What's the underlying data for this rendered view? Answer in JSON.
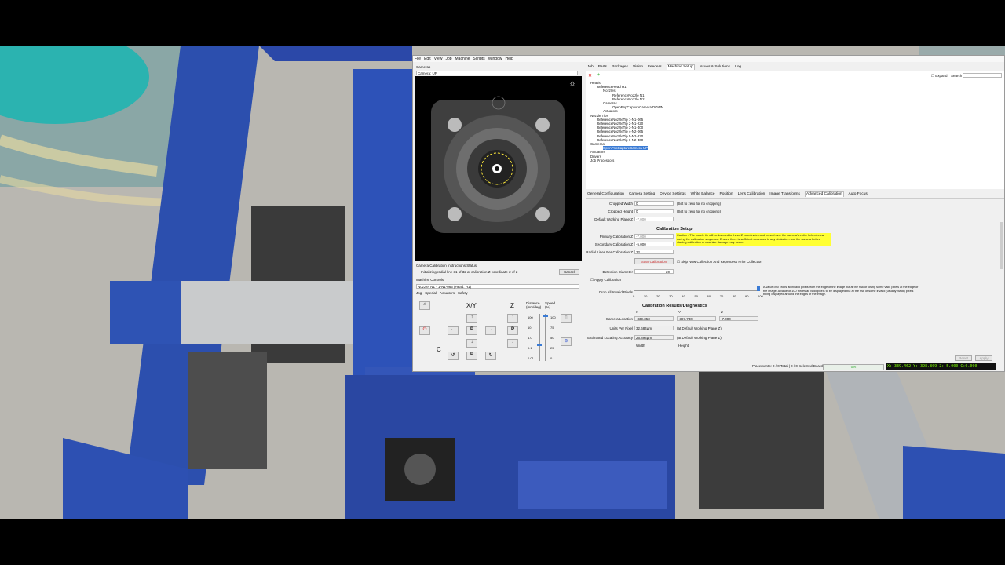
{
  "menu": [
    "File",
    "Edit",
    "View",
    "Job",
    "Machine",
    "Scripts",
    "Window",
    "Help"
  ],
  "camera_panel": {
    "title": "Cameras",
    "selected": "Camera: UP"
  },
  "calibration_status": {
    "title": "Camera Calibration Instructions/Status",
    "message": "Initializing radial line 31 of 32 at calibration Z coordinate 2 of 2",
    "cancel_label": "Cancel"
  },
  "machine_controls": {
    "title": "Machine Controls",
    "nozzle": "Nozzle: N1 - 1-N1-065 (Head: H1)",
    "tabs": [
      "Jog",
      "Special",
      "Actuators",
      "Safety"
    ],
    "xy_label": "X/Y",
    "z_label": "Z",
    "c_label": "C",
    "park_label": "P",
    "distance_label": "Distance (mm/deg)",
    "speed_label": "Speed (%)",
    "distance_ticks": [
      "100",
      "10",
      "1.0",
      "0.1",
      "0.01"
    ],
    "speed_ticks": [
      "100",
      "75",
      "50",
      "25",
      "0"
    ]
  },
  "right_tabs": [
    "Job",
    "Parts",
    "Packages",
    "Vision",
    "Feeders",
    "Machine Setup",
    "Issues & Solutions",
    "Log"
  ],
  "active_right_tab": "Machine Setup",
  "expand_label": "Expand",
  "search_label": "Search",
  "tree": [
    "Heads",
    "ReferenceHead H1",
    "Nozzles",
    "ReferenceNozzle N1",
    "ReferenceNozzle N2",
    "Cameras",
    "OpenPnpCaptureCamera DOWN",
    "Actuators",
    "Nozzle Tips",
    "ReferenceNozzleTip 1-N1-065",
    "ReferenceNozzleTip 2-N1-220",
    "ReferenceNozzleTip 3-N1-400",
    "ReferenceNozzleTip 4-N2-065",
    "ReferenceNozzleTip 5-N2-220",
    "ReferenceNozzleTip 6-N2-400",
    "Cameras",
    "OpenPnpCaptureCamera UP",
    "Actuators",
    "Drivers",
    "Job Processors"
  ],
  "cam_tabs": [
    "General Configuration",
    "Camera Setting",
    "Device Settings",
    "White Balance",
    "Position",
    "Lens Calibration",
    "Image Transforms",
    "Advanced Calibration",
    "Auto Focus"
  ],
  "active_cam_tab": "Advanced Calibration",
  "crop": {
    "width_label": "Cropped Width",
    "width_value": "0",
    "width_hint": "(Set to zero for no cropping)",
    "height_label": "Cropped Height",
    "height_value": "0",
    "height_hint": "(Set to zero for no cropping)",
    "dwp_label": "Default Working Plane Z",
    "dwp_value": "-7.000"
  },
  "calibration_setup": {
    "title": "Calibration Setup",
    "primary_label": "Primary Calibration Z",
    "primary_value": "-7.000",
    "secondary_label": "Secondary Calibration Z",
    "secondary_value": "-5.000",
    "radial_label": "Radial Lines Per Calibration Z",
    "radial_value": "32",
    "caution": "Caution - The nozzle tip will be lowered to these Z coordinates and moved over the camera's entire field-of-view during the calibration sequence. Ensure there is sufficient clearance to any obstacles near the camera before starting calibration or machine damage may occur.",
    "start_label": "Start Calibration",
    "skip_label": "Skip New Collection And Reprocess Prior Collection",
    "detection_label": "Detection Diameter",
    "detection_value": "20",
    "apply_label": "Apply Calibration",
    "crop_label": "Crop All Invalid Pixels",
    "crop_ticks": [
      "0",
      "10",
      "20",
      "30",
      "40",
      "50",
      "60",
      "70",
      "80",
      "90",
      "100"
    ],
    "crop_note": "A value of 0 crops all invalid pixels from the edge of the image but at the risk of losing some valid pixels at the edge of the image. A value of 100 forces all valid pixels to be displayed but at the risk of some invalid (usually black) pixels being displayed around the edges of the image."
  },
  "results": {
    "title": "Calibration Results/Diagnostics",
    "cols": [
      "X",
      "Y",
      "Z"
    ],
    "location_label": "Camera Location",
    "location": [
      "-339.353",
      "-397.740",
      "-7.000"
    ],
    "upp_label": "Units Per Pixel",
    "upp_value": "32.684µm",
    "upp_note": "(at Default Working Plane Z)",
    "accuracy_label": "Estimated Locating Accuracy",
    "accuracy_value": "26.894µm",
    "accuracy_note": "(at Default Working Plane Z)",
    "width_label": "Width",
    "height_label": "Height"
  },
  "reset_label": "Reset",
  "apply_btn_label": "Apply",
  "status": {
    "placements": "Placements: 0 / 0 Total | 0 / 0 Selected Board",
    "progress": "0%",
    "coords": "X:-339.462  Y:-398.809  Z:-5.000  C:0.000"
  }
}
